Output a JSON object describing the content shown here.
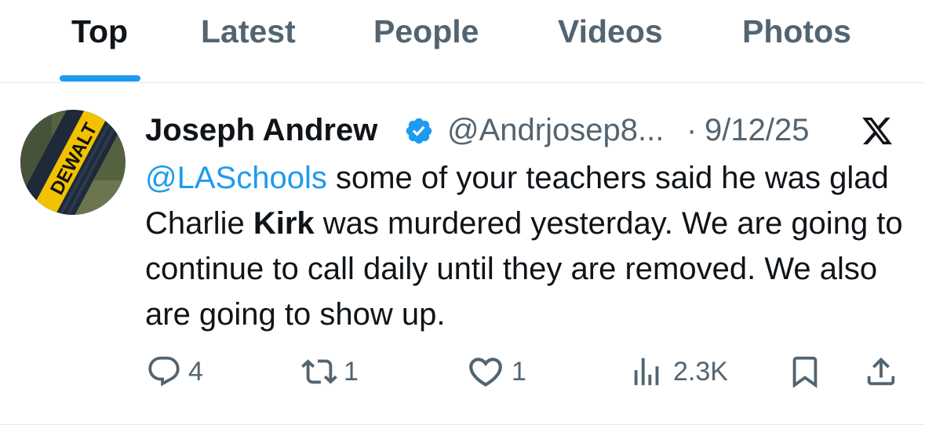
{
  "tabs": [
    {
      "label": "Top",
      "active": true
    },
    {
      "label": "Latest",
      "active": false
    },
    {
      "label": "People",
      "active": false
    },
    {
      "label": "Videos",
      "active": false
    },
    {
      "label": "Photos",
      "active": false
    }
  ],
  "tweet": {
    "author_name": "Joseph Andrew",
    "handle": "@Andrjosep8...",
    "separator": "·",
    "date": "9/12/25",
    "avatar_text": "DEWALT",
    "text_parts": {
      "mention": "@LASchools",
      "part1": " some of your teachers said he was glad Charlie ",
      "bold": "Kirk",
      "part2": " was murdered yesterday. We are going to continue to call daily until they are removed. We also are going to show up."
    },
    "replies": "4",
    "reposts": "1",
    "likes": "1",
    "views": "2.3K"
  },
  "icons": [
    "verified-badge-icon",
    "x-logo-icon",
    "reply-icon",
    "repost-icon",
    "like-icon",
    "views-icon",
    "bookmark-icon",
    "share-icon"
  ],
  "colors": {
    "accent": "#1d9bf0",
    "text": "#0f1419",
    "secondary": "#536471",
    "border": "#e6e9ea"
  }
}
